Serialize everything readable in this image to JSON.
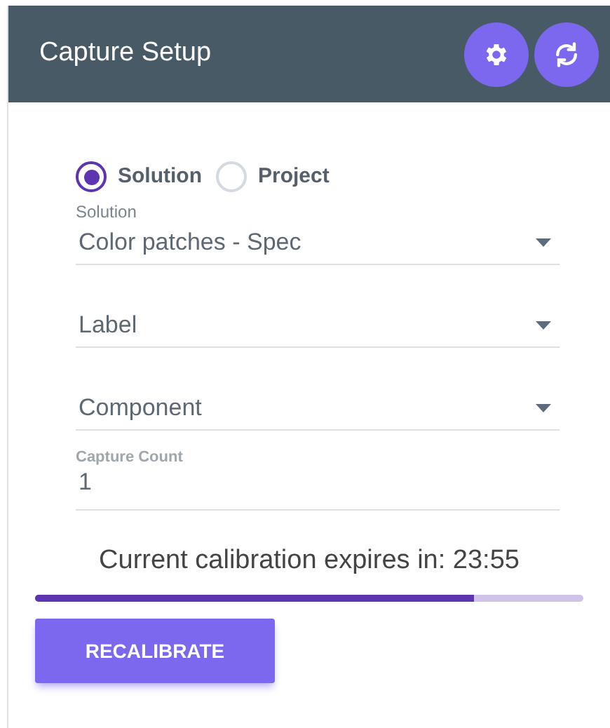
{
  "header": {
    "title": "Capture Setup"
  },
  "header_buttons": [
    {
      "kind": "settings"
    },
    {
      "kind": "refresh"
    }
  ],
  "source_options": [
    {
      "label": "Solution",
      "selected": true
    },
    {
      "label": "Project",
      "selected": false
    }
  ],
  "fields": [
    {
      "kind": "select",
      "label": "Solution",
      "value": "Color patches - Spec"
    },
    {
      "kind": "select",
      "placeholder": "Label"
    },
    {
      "kind": "select",
      "placeholder": "Component"
    },
    {
      "kind": "text",
      "label": "Capture Count",
      "value": "1"
    }
  ],
  "calibration": {
    "text": "Current calibration expires in: 23:55",
    "level": 0.8
  },
  "buttons": [
    "RECALIBRATE"
  ]
}
